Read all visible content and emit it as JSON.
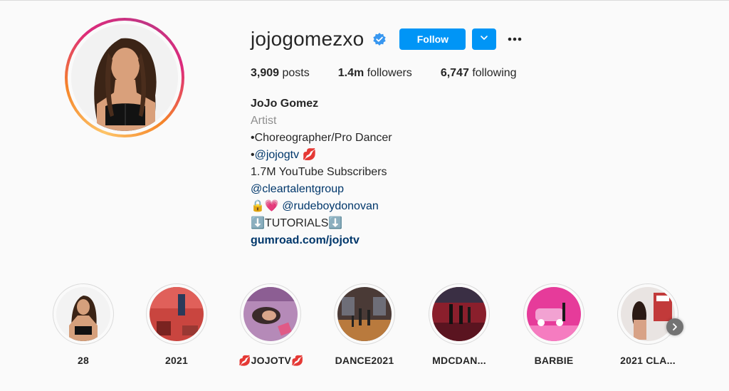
{
  "profile": {
    "username": "jojogomezxo",
    "follow_label": "Follow",
    "stats": {
      "posts_count": "3,909",
      "posts_label": "posts",
      "followers_count": "1.4m",
      "followers_label": "followers",
      "following_count": "6,747",
      "following_label": "following"
    },
    "bio": {
      "full_name": "JoJo Gomez",
      "category": "Artist",
      "line1": "•Choreographer/Pro Dancer",
      "line2_prefix": "•",
      "line2_link": "@jojogtv",
      "line2_emoji": "💋",
      "line3": "1.7M YouTube Subscribers",
      "line4_link": "@cleartalentgroup",
      "line5_emoji": "🔒💗",
      "line5_link": "@rudeboydonovan",
      "line6_emoji_left": "⬇️",
      "line6_text": "TUTORIALS",
      "line6_emoji_right": "⬇️",
      "website": "gumroad.com/jojotv"
    }
  },
  "highlights": [
    {
      "label": "28"
    },
    {
      "label": "2021"
    },
    {
      "label": "💋JOJOTV💋"
    },
    {
      "label": "DANCE2021"
    },
    {
      "label": "MDCDAN..."
    },
    {
      "label": "BARBIE"
    },
    {
      "label": "2021 CLA..."
    }
  ],
  "colors": {
    "accent": "#0095f6",
    "link": "#00376b",
    "muted": "#8e8e8e",
    "verified": "#3897f0"
  },
  "icons": {
    "verified": "verified-badge-icon",
    "dropdown": "chevron-down-icon",
    "more": "more-options-icon",
    "next": "chevron-right-icon"
  }
}
